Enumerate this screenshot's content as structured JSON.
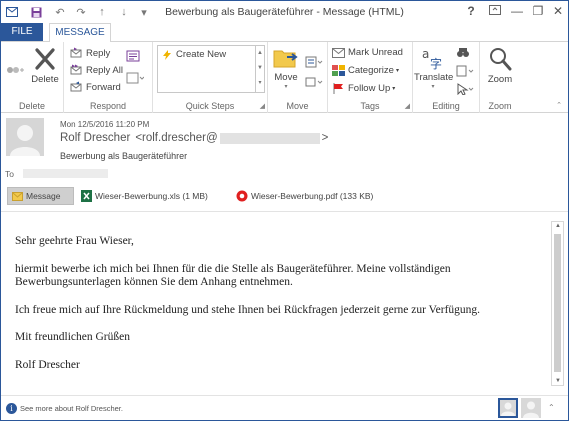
{
  "window": {
    "title": "Bewerbung als Baugeräteführer - Message (HTML)"
  },
  "window_controls": {
    "help": "?",
    "minimize": "—",
    "restore": "❐",
    "close": "✕"
  },
  "quick_access": {
    "undo": "↶",
    "redo": "↷",
    "up": "↑",
    "down": "↓",
    "more": "▾"
  },
  "tabs": {
    "file": "FILE",
    "message": "MESSAGE"
  },
  "ribbon": {
    "delete_group": {
      "label": "Delete",
      "delete": "Delete"
    },
    "respond_group": {
      "label": "Respond",
      "reply": "Reply",
      "reply_all": "Reply All",
      "forward": "Forward"
    },
    "quicksteps_group": {
      "label": "Quick Steps",
      "create_new": "Create New"
    },
    "move_group": {
      "label": "Move",
      "move": "Move"
    },
    "tags_group": {
      "label": "Tags",
      "mark_unread": "Mark Unread",
      "categorize": "Categorize",
      "follow_up": "Follow Up"
    },
    "editing_group": {
      "label": "Editing",
      "translate": "Translate"
    },
    "zoom_group": {
      "label": "Zoom",
      "zoom": "Zoom"
    }
  },
  "header": {
    "date": "Mon 12/5/2016 11:20 PM",
    "sender_name": "Rolf Drescher",
    "sender_email_prefix": "<rolf.drescher@",
    "sender_email_suffix": ">",
    "subject": "Bewerbung als Baugeräteführer",
    "to_label": "To"
  },
  "attachments": [
    {
      "name": "Message",
      "type": "message"
    },
    {
      "name": "Wieser-Bewerbung.xls (1 MB)",
      "type": "excel"
    },
    {
      "name": "Wieser-Bewerbung.pdf (133 KB)",
      "type": "pdf"
    }
  ],
  "body": {
    "greeting": "Sehr geehrte Frau Wieser,",
    "paragraph1": "hiermit bewerbe ich mich bei Ihnen für die die Stelle als Baugeräteführer. Meine vollständigen Bewerbungsunterlagen können Sie dem Anhang entnehmen.",
    "paragraph2": "Ich freue mich auf Ihre Rückmeldung und stehe Ihnen bei Rückfragen jederzeit gerne zur Verfügung.",
    "closing": "Mit freundlichen Grüßen",
    "signature": "Rolf Drescher"
  },
  "people_pane": {
    "text": "See more about Rolf Drescher."
  },
  "colors": {
    "accent": "#2b579a",
    "excel": "#1e7145",
    "pdf": "#e02020"
  }
}
